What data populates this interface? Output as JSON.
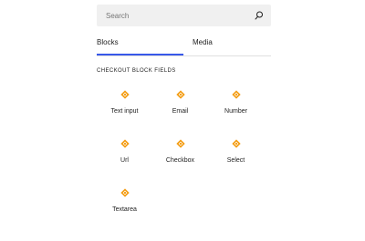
{
  "search": {
    "placeholder": "Search",
    "icon": "search-icon"
  },
  "tabs": [
    {
      "label": "Blocks",
      "active": true
    },
    {
      "label": "Media",
      "active": false
    }
  ],
  "section": {
    "title": "CHECKOUT BLOCK FIELDS"
  },
  "blocks": [
    {
      "label": "Text input",
      "icon": "block-field-icon"
    },
    {
      "label": "Email",
      "icon": "block-field-icon"
    },
    {
      "label": "Number",
      "icon": "block-field-icon"
    },
    {
      "label": "Url",
      "icon": "block-field-icon"
    },
    {
      "label": "Checkbox",
      "icon": "block-field-icon"
    },
    {
      "label": "Select",
      "icon": "block-field-icon"
    },
    {
      "label": "Textarea",
      "icon": "block-field-icon"
    }
  ],
  "colors": {
    "accent": "#3858e9",
    "icon": "#f39c12",
    "search_bg": "#f0f0f0"
  }
}
